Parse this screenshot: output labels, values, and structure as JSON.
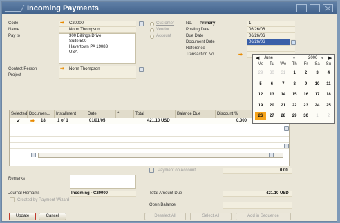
{
  "window": {
    "title": "Incoming Payments"
  },
  "header": {
    "code_label": "Code",
    "code_value": "C20000",
    "name_label": "Name",
    "name_value": "Norm Thompson",
    "payto_label": "Pay to",
    "address_lines": [
      "300 Billings Drive",
      "Suite 500",
      "Havertown PA  19083",
      "USA"
    ],
    "contact_label": "Contact Person",
    "contact_value": "Norm Thompson",
    "project_label": "Project",
    "radio_customer": "Customer",
    "radio_vendor": "Vendor",
    "radio_account": "Account",
    "no_label": "No.",
    "no_series": "Primary",
    "no_value": "1",
    "posting_label": "Posting Date",
    "posting_value": "06/26/06",
    "due_label": "Due Date",
    "due_value": "06/26/06",
    "docdate_label": "Document Date",
    "docdate_value": "06/26/06",
    "reference_label": "Reference",
    "transaction_label": "Transaction No."
  },
  "grid": {
    "columns": [
      "Selected",
      "Documen...",
      "Installment",
      "Date",
      "*",
      "Total",
      "Balance Due",
      "Discount %"
    ],
    "rows": [
      {
        "selected": "✔",
        "document": "18",
        "installment": "1 of 1",
        "date": "01/01/05",
        "total": "421.10 USD",
        "balance": "",
        "discount": "0.000"
      }
    ]
  },
  "calendar": {
    "month": "June",
    "year": "2006",
    "weekdays": [
      "Mo",
      "Tu",
      "We",
      "Th",
      "Fr",
      "Sa",
      "Su"
    ],
    "weeks": [
      [
        {
          "d": "29",
          "f": true
        },
        {
          "d": "30",
          "f": true
        },
        {
          "d": "31",
          "f": true
        },
        {
          "d": "1"
        },
        {
          "d": "2"
        },
        {
          "d": "3"
        },
        {
          "d": "4"
        }
      ],
      [
        {
          "d": "5"
        },
        {
          "d": "6"
        },
        {
          "d": "7"
        },
        {
          "d": "8"
        },
        {
          "d": "9"
        },
        {
          "d": "10"
        },
        {
          "d": "11"
        }
      ],
      [
        {
          "d": "12"
        },
        {
          "d": "13"
        },
        {
          "d": "14"
        },
        {
          "d": "15"
        },
        {
          "d": "16"
        },
        {
          "d": "17"
        },
        {
          "d": "18"
        }
      ],
      [
        {
          "d": "19"
        },
        {
          "d": "20"
        },
        {
          "d": "21"
        },
        {
          "d": "22"
        },
        {
          "d": "23"
        },
        {
          "d": "24"
        },
        {
          "d": "25"
        }
      ],
      [
        {
          "d": "26",
          "t": true
        },
        {
          "d": "27"
        },
        {
          "d": "28"
        },
        {
          "d": "29"
        },
        {
          "d": "30"
        },
        {
          "d": "1",
          "f": true
        },
        {
          "d": "2",
          "f": true
        }
      ]
    ]
  },
  "footer": {
    "payment_on_account": "Payment on Account",
    "payment_on_account_value": "0.00",
    "remarks_label": "Remarks",
    "journal_label": "Journal Remarks",
    "journal_value": "Incoming - C20000",
    "created_wizard": "Created by Payment Wizard",
    "total_label": "Total Amount Due",
    "total_value": "421.10 USD",
    "open_balance_label": "Open Balance"
  },
  "buttons": {
    "update": "Update",
    "cancel": "Cancel",
    "deselect_all": "Deselect All",
    "select_all": "Select All",
    "add_in_sequence": "Add in Sequence"
  },
  "colors": {
    "title_bar": "#4a6b94",
    "accent_orange": "#f6a31b",
    "form_bg": "#eae6d8"
  }
}
